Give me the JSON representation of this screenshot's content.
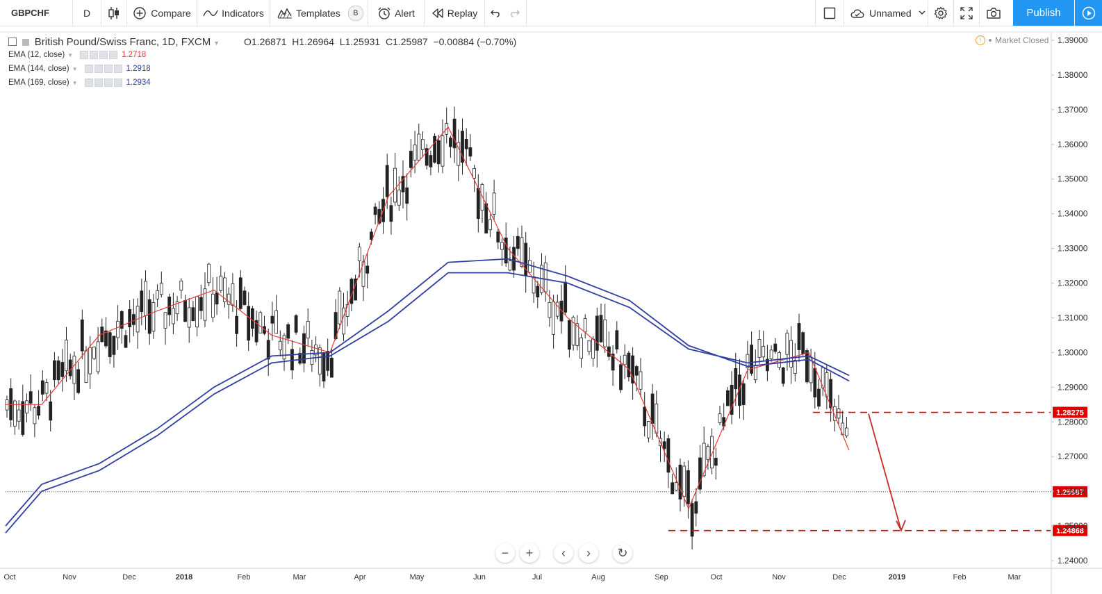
{
  "toolbar": {
    "symbol": "GBPCHF",
    "interval": "D",
    "compare": "Compare",
    "indicators": "Indicators",
    "templates": "Templates",
    "templates_badge": "B",
    "alert": "Alert",
    "replay": "Replay",
    "layout_name": "Unnamed",
    "publish": "Publish"
  },
  "legend": {
    "title": "British Pound/Swiss Franc, 1D, FXCM",
    "open": "O1.26871",
    "high": "H1.26964",
    "low": "L1.25931",
    "close": "C1.25987",
    "change": "−0.00884 (−0.70%)",
    "market_status": "Market Closed",
    "indicators": [
      {
        "label": "EMA (12, close)",
        "value": "1.2718",
        "color": "#e53935"
      },
      {
        "label": "EMA (144, close)",
        "value": "1.2918",
        "color": "#303f9f"
      },
      {
        "label": "EMA (169, close)",
        "value": "1.2934",
        "color": "#303f9f"
      }
    ]
  },
  "price_axis": {
    "ticks": [
      "1.39000",
      "1.38000",
      "1.37000",
      "1.36000",
      "1.35000",
      "1.34000",
      "1.33000",
      "1.32000",
      "1.31000",
      "1.30000",
      "1.29000",
      "1.28000",
      "1.27000",
      "1.26000",
      "1.25000",
      "1.24000"
    ],
    "labels": [
      {
        "text": "1.28275",
        "value": 1.28275,
        "color": "#e00000"
      },
      {
        "text": "1.25987",
        "value": 1.25987,
        "color": "#e00000"
      },
      {
        "text": "1.24868",
        "value": 1.24868,
        "color": "#e00000"
      }
    ]
  },
  "time_axis": {
    "ticks": [
      "Oct",
      "Nov",
      "Dec",
      "2018",
      "Feb",
      "Mar",
      "Apr",
      "May",
      "Jun",
      "Jul",
      "Aug",
      "Sep",
      "Oct",
      "Nov",
      "Dec",
      "2019",
      "Feb",
      "Mar"
    ]
  },
  "chart_data": {
    "type": "line",
    "title": "British Pound/Swiss Franc, 1D, FXCM",
    "ylim": [
      1.235,
      1.395
    ],
    "x": [
      "2017-10",
      "2017-11",
      "2017-12",
      "2018-01",
      "2018-02",
      "2018-03",
      "2018-04",
      "2018-05",
      "2018-06",
      "2018-07",
      "2018-08",
      "2018-09",
      "2018-10",
      "2018-11",
      "2018-12"
    ],
    "series": [
      {
        "name": "EMA (12, close)",
        "values": [
          1.285,
          1.305,
          1.312,
          1.318,
          1.305,
          1.3,
          1.345,
          1.365,
          1.33,
          1.31,
          1.295,
          1.255,
          1.295,
          1.3,
          1.2718
        ]
      },
      {
        "name": "EMA (144, close)",
        "values": [
          1.262,
          1.268,
          1.278,
          1.29,
          1.299,
          1.3,
          1.312,
          1.326,
          1.327,
          1.322,
          1.315,
          1.302,
          1.296,
          1.298,
          1.2918
        ]
      },
      {
        "name": "EMA (169, close)",
        "values": [
          1.26,
          1.266,
          1.276,
          1.288,
          1.297,
          1.299,
          1.309,
          1.323,
          1.323,
          1.32,
          1.313,
          1.301,
          1.297,
          1.299,
          1.2934
        ]
      }
    ],
    "annotations": [
      {
        "type": "hline",
        "value": 1.28275,
        "style": "dashed"
      },
      {
        "type": "hline",
        "value": 1.24868,
        "style": "dashed"
      },
      {
        "type": "hline",
        "value": 1.25987,
        "style": "dotted"
      },
      {
        "type": "arrow",
        "from": 1.28275,
        "to": 1.24868
      }
    ],
    "last_close": 1.25987
  }
}
